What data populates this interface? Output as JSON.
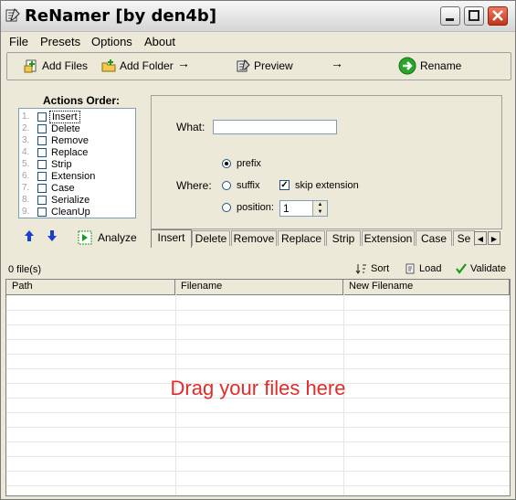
{
  "window": {
    "title": "ReNamer  [by den4b]"
  },
  "menu": [
    "File",
    "Presets",
    "Options",
    "About"
  ],
  "toolbar": {
    "add_files": "Add Files",
    "add_folder": "Add Folder",
    "preview": "Preview",
    "rename": "Rename",
    "arrow": "→"
  },
  "actions": {
    "title": "Actions Order:",
    "items": [
      {
        "num": "1.",
        "label": "Insert"
      },
      {
        "num": "2.",
        "label": "Delete"
      },
      {
        "num": "3.",
        "label": "Remove"
      },
      {
        "num": "4.",
        "label": "Replace"
      },
      {
        "num": "5.",
        "label": "Strip"
      },
      {
        "num": "6.",
        "label": "Extension"
      },
      {
        "num": "7.",
        "label": "Case"
      },
      {
        "num": "8.",
        "label": "Serialize"
      },
      {
        "num": "9.",
        "label": "CleanUp"
      }
    ],
    "analyze": "Analyze"
  },
  "insert_panel": {
    "what_label": "What:",
    "what_value": "",
    "where_label": "Where:",
    "prefix": "prefix",
    "suffix": "suffix",
    "skip_extension": "skip extension",
    "position": "position:",
    "position_value": "1"
  },
  "tabs": [
    "Insert",
    "Delete",
    "Remove",
    "Replace",
    "Strip",
    "Extension",
    "Case",
    "Se"
  ],
  "status": {
    "file_count": "0 file(s)",
    "sort": "Sort",
    "load": "Load",
    "validate": "Validate"
  },
  "table": {
    "columns": [
      "Path",
      "Filename",
      "New Filename"
    ],
    "empty_hint": "Drag your files here"
  },
  "colors": {
    "hint_red": "#e22b2b",
    "arrow_blue": "#1d3fcf",
    "rename_green": "#27a629"
  }
}
